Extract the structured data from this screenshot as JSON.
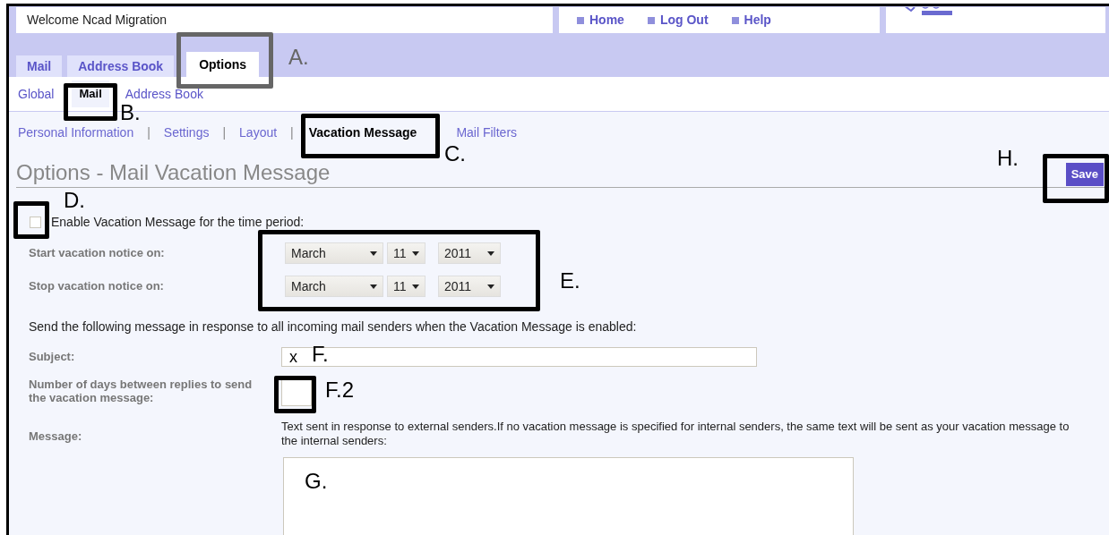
{
  "header": {
    "welcome": "Welcome Ncad Migration",
    "links": [
      "Home",
      "Log Out",
      "Help"
    ]
  },
  "tabs": [
    {
      "label": "Mail",
      "selected": false
    },
    {
      "label": "Address Book",
      "selected": false
    },
    {
      "label": "Options",
      "selected": true
    }
  ],
  "subtabs": [
    {
      "label": "Global",
      "selected": false
    },
    {
      "label": "Mail",
      "selected": true
    },
    {
      "label": "Address Book",
      "selected": false
    }
  ],
  "sections": [
    {
      "label": "Personal Information",
      "selected": false,
      "separator": "|"
    },
    {
      "label": "Settings",
      "selected": false,
      "separator": "|"
    },
    {
      "label": "Layout",
      "selected": false,
      "separator": "|"
    },
    {
      "label": "Vacation Message",
      "selected": true
    },
    {
      "label": "Mail Filters",
      "selected": false
    }
  ],
  "title": "Options - Mail Vacation Message",
  "save_button": "Save",
  "enable": {
    "label": "Enable Vacation Message for the time period:",
    "checked": false
  },
  "dates": [
    {
      "label": "Start vacation notice on:",
      "month": "March",
      "day": "11",
      "year": "2011"
    },
    {
      "label": "Stop vacation notice on:",
      "month": "March",
      "day": "11",
      "year": "2011"
    }
  ],
  "intro": "Send the following message in response to all incoming mail senders when the Vacation Message is enabled:",
  "subject": {
    "label": "Subject:",
    "value": "x"
  },
  "days": {
    "label": "Number of days between replies to send the vacation message:"
  },
  "message": {
    "label": "Message:",
    "hint": "Text sent in response to external senders.If no vacation message is specified for internal senders, the same text will be sent as your vacation message to the internal senders:"
  },
  "annotations": [
    {
      "label": "A.",
      "color": "#666666"
    },
    {
      "label": "B.",
      "color": "#000000"
    },
    {
      "label": "C.",
      "color": "#000000"
    },
    {
      "label": "D.",
      "color": "#000000"
    },
    {
      "label": "E.",
      "color": "#000000"
    },
    {
      "label": "F.",
      "color": "#000000"
    },
    {
      "label": "F.2",
      "color": "#000000"
    },
    {
      "label": "G.",
      "color": "#000000"
    },
    {
      "label": "H.",
      "color": "#000000"
    }
  ]
}
